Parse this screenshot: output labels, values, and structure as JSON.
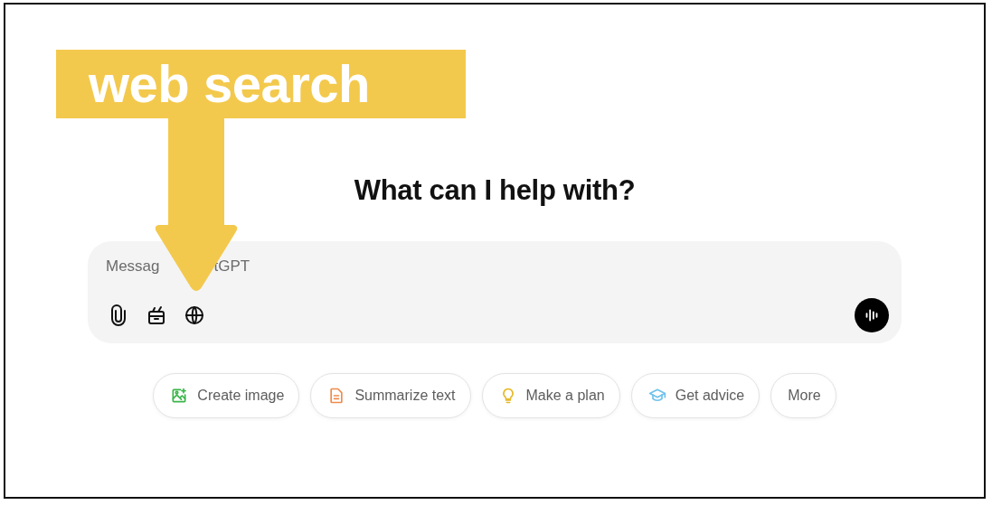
{
  "annotation": {
    "label": "web search"
  },
  "heading": "What can I help with?",
  "composer": {
    "placeholder_parts": [
      "Messag",
      "tGPT"
    ],
    "tools": [
      {
        "kind": "attach"
      },
      {
        "kind": "toolbox"
      },
      {
        "kind": "globe"
      }
    ],
    "voice_button": {
      "kind": "voice"
    }
  },
  "suggestions": [
    {
      "label": "Create image",
      "kind": "image",
      "color": "#3bb54a"
    },
    {
      "label": "Summarize text",
      "kind": "document",
      "color": "#f08a4b"
    },
    {
      "label": "Make a plan",
      "kind": "bulb",
      "color": "#e7b92c"
    },
    {
      "label": "Get advice",
      "kind": "cap",
      "color": "#6ec1ec"
    },
    {
      "label": "More",
      "kind": "plain"
    }
  ]
}
